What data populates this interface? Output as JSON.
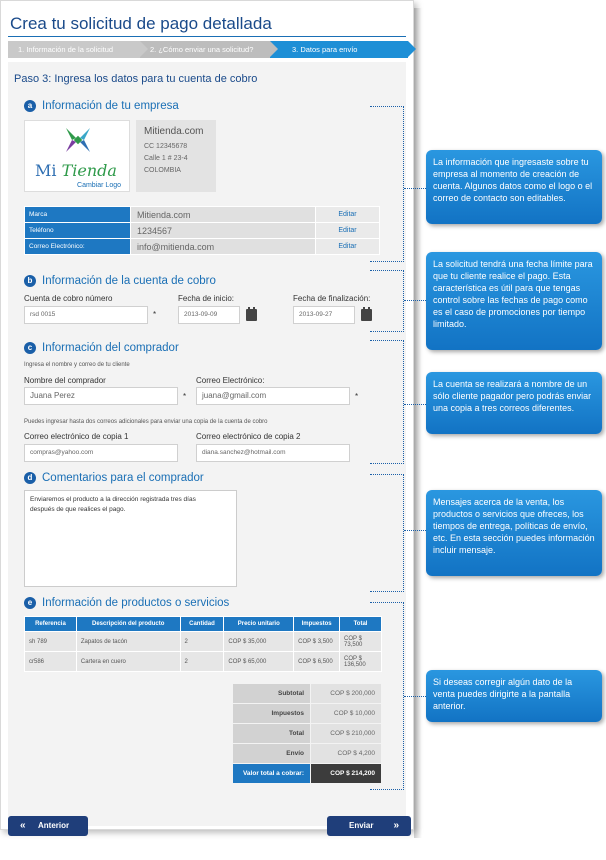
{
  "page": {
    "title": "Crea tu solicitud de pago detallada",
    "steps": [
      "1. Información de la solicitud",
      "2. ¿Cómo enviar una solicitud?",
      "3. Datos para envío"
    ],
    "paso_title": "Paso 3: Ingresa los datos para tu cuenta de cobro"
  },
  "sections": {
    "a": {
      "letter": "a",
      "title": "Información de tu empresa"
    },
    "b": {
      "letter": "b",
      "title": "Información de la cuenta de cobro"
    },
    "c": {
      "letter": "c",
      "title": "Información del comprador"
    },
    "d": {
      "letter": "d",
      "title": "Comentarios para el comprador"
    },
    "e": {
      "letter": "e",
      "title": "Información de productos o servicios"
    }
  },
  "company": {
    "logo_text_1": "Mi",
    "logo_text_2": "Tienda",
    "change_logo": "Cambiar Logo",
    "name": "Mitienda.com",
    "cc": "CC 12345678",
    "address": "Calle 1 # 23-4",
    "country": "COLOMBIA",
    "rows": [
      {
        "label": "Marca",
        "value": "Mitienda.com",
        "action": "Editar"
      },
      {
        "label": "Teléfono",
        "value": "1234567",
        "action": "Editar"
      },
      {
        "label": "Correo Electrónico:",
        "value": "info@mitienda.com",
        "action": "Editar"
      }
    ]
  },
  "cuenta": {
    "numero_label": "Cuenta de cobro número",
    "numero_value": "rsd 0015",
    "inicio_label": "Fecha de inicio:",
    "inicio_value": "2013-09-09",
    "fin_label": "Fecha de finalización:",
    "fin_value": "2013-09-27",
    "required_mark": "*"
  },
  "comprador": {
    "hint": "Ingresa el nombre y correo de tu cliente",
    "nombre_label": "Nombre del comprador",
    "nombre_value": "Juana Perez",
    "correo_label": "Correo Electrónico:",
    "correo_value": "juana@gmail.com",
    "copias_hint": "Puedes ingresar hasta dos correos adicionales para enviar una copia de la cuenta de cobro",
    "copia1_label": "Correo electrónico de copia 1",
    "copia1_value": "compras@yahoo.com",
    "copia2_label": "Correo electrónico de copia 2",
    "copia2_value": "diana.sanchez@hotmail.com"
  },
  "comentarios": {
    "text": "Enviaremos el producto a la dirección registrada tres días\ndespués de que realices el pago."
  },
  "productos": {
    "headers": [
      "Referencia",
      "Descripción del producto",
      "Cantidad",
      "Precio unitario",
      "Impuestos",
      "Total"
    ],
    "rows": [
      {
        "ref": "sh 789",
        "desc": "Zapatos de tacón",
        "qty": "2",
        "price": "COP $ 35,000",
        "tax": "COP $ 3,500",
        "total": "COP $ 73,500"
      },
      {
        "ref": "cr586",
        "desc": "Cartera en cuero",
        "qty": "2",
        "price": "COP $ 65,000",
        "tax": "COP $ 6,500",
        "total": "COP $ 136,500"
      }
    ],
    "totals": [
      {
        "label": "Subtotal",
        "value": "COP $ 200,000"
      },
      {
        "label": "Impuestos",
        "value": "COP $ 10,000"
      },
      {
        "label": "Total",
        "value": "COP $ 210,000"
      },
      {
        "label": "Envío",
        "value": "COP $ 4,200"
      },
      {
        "label": "Valor total a cobrar:",
        "value": "COP $ 214,200"
      }
    ]
  },
  "buttons": {
    "prev": "Anterior",
    "next": "Enviar",
    "prev_chev": "«",
    "next_chev": "»"
  },
  "callouts": [
    "La información que ingresaste sobre tu empresa al momento de creación de cuenta. Algunos datos como el logo o el correo de contacto son editables.",
    "La solicitud tendrá una fecha límite para que tu cliente realice el pago.  Esta característica es útil para que tengas control sobre las fechas de pago como es el caso de  promociones por tiempo limitado.",
    "La cuenta se realizará a nombre de un sólo cliente pagador pero podrás enviar una copia a tres correos diferentes.",
    "Mensajes acerca de la venta, los productos o servicios que ofreces, los tiempos de entrega, políticas de envío, etc. En esta sección puedes información incluir mensaje.",
    "Si deseas corregir algún dato de la venta puedes dirigirte a la pantalla anterior."
  ],
  "colors": {
    "accent": "#1e78c2",
    "title": "#1a4a8a",
    "button": "#1f3e7a"
  }
}
